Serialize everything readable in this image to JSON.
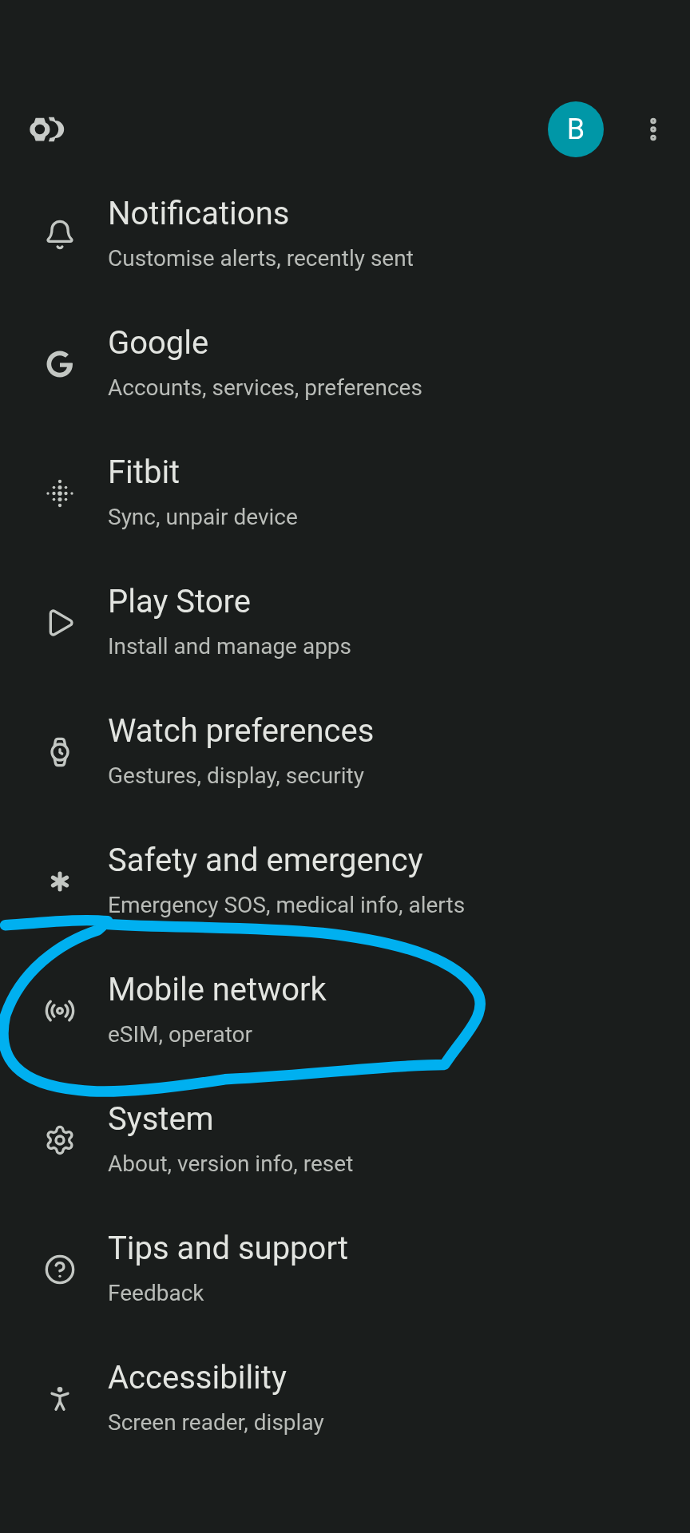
{
  "header": {
    "avatar": "B"
  },
  "items": [
    {
      "kind": "bell",
      "title": "Notifications",
      "subtitle": "Customise alerts, recently sent"
    },
    {
      "kind": "google",
      "title": "Google",
      "subtitle": "Accounts, services, preferences"
    },
    {
      "kind": "dots",
      "title": "Fitbit",
      "subtitle": "Sync, unpair device"
    },
    {
      "kind": "play",
      "title": "Play Store",
      "subtitle": "Install and manage apps"
    },
    {
      "kind": "watch",
      "title": "Watch preferences",
      "subtitle": "Gestures, display, security"
    },
    {
      "kind": "medical",
      "title": "Safety and emergency",
      "subtitle": "Emergency SOS, medical info, alerts"
    },
    {
      "kind": "signal",
      "title": "Mobile network",
      "subtitle": "eSIM, operator"
    },
    {
      "kind": "gear",
      "title": "System",
      "subtitle": "About, version info, reset"
    },
    {
      "kind": "help",
      "title": "Tips and support",
      "subtitle": "Feedback"
    },
    {
      "kind": "person",
      "title": "Accessibility",
      "subtitle": "Screen reader, display"
    }
  ],
  "annotation": {
    "kind": "scribble",
    "color": "#00b0f0"
  }
}
